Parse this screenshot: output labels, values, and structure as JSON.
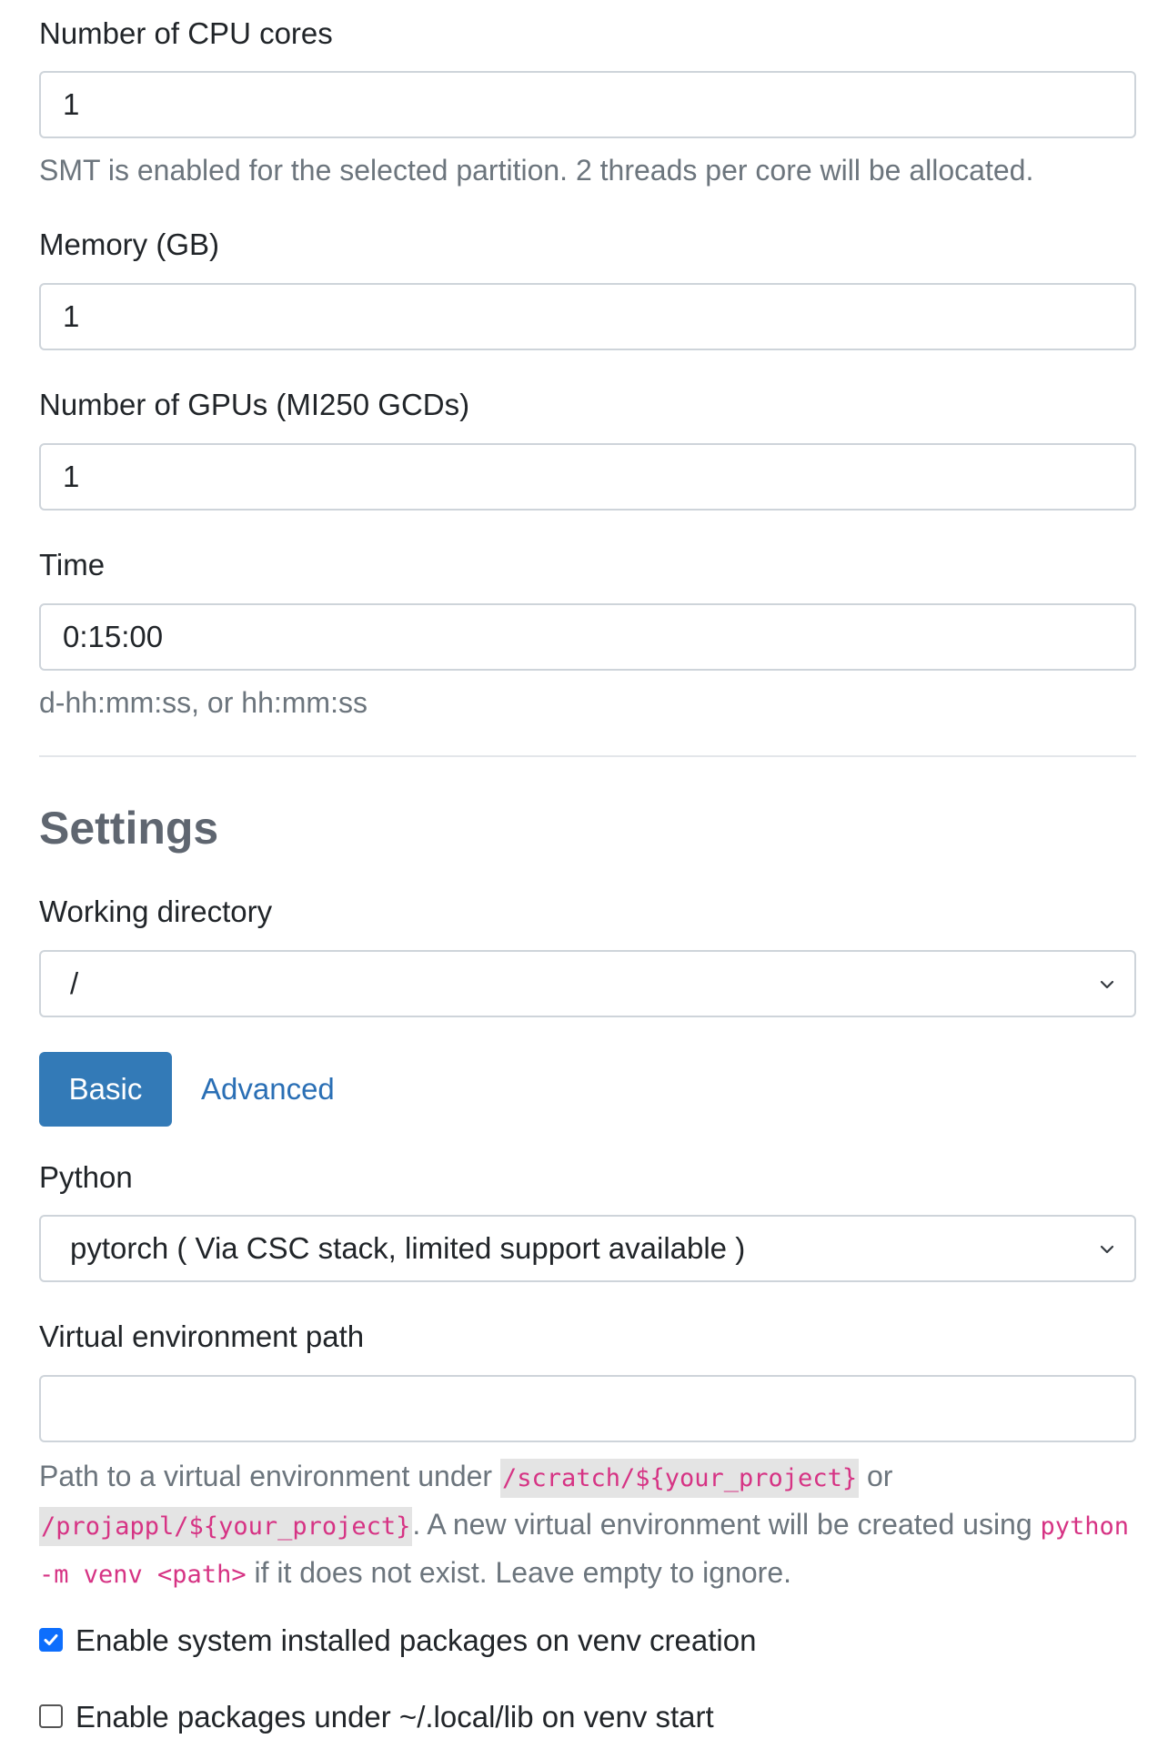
{
  "resources": {
    "cpu": {
      "label": "Number of CPU cores",
      "value": "1",
      "help": "SMT is enabled for the selected partition. 2 threads per core will be allocated."
    },
    "memory": {
      "label": "Memory (GB)",
      "value": "1"
    },
    "gpus": {
      "label": "Number of GPUs (MI250 GCDs)",
      "value": "1"
    },
    "time": {
      "label": "Time",
      "value": "0:15:00",
      "help": "d-hh:mm:ss, or hh:mm:ss"
    }
  },
  "settings": {
    "heading": "Settings",
    "working_directory": {
      "label": "Working directory",
      "selected": "/"
    },
    "tabs": {
      "basic": "Basic",
      "advanced": "Advanced"
    },
    "python": {
      "label": "Python",
      "selected": "pytorch ( Via CSC stack, limited support available )"
    },
    "venv": {
      "label": "Virtual environment path",
      "value": "",
      "help_prefix": "Path to a virtual environment under ",
      "path1": "/scratch/${your_project}",
      "help_or": " or ",
      "path2": "/projappl/${your_project}",
      "help_mid": ". A new virtual environment will be created using ",
      "cmd": "python -m venv <path>",
      "help_suffix": " if it does not exist. Leave empty to ignore."
    },
    "checkboxes": [
      {
        "label": "Enable system installed packages on venv creation",
        "checked": true
      },
      {
        "label": "Enable packages under ~/.local/lib on venv start",
        "checked": false
      }
    ]
  },
  "colors": {
    "primary_button": "#337ab7",
    "link": "#2a6fb5",
    "code": "#d63384",
    "checkbox_checked": "#0d6efd"
  }
}
